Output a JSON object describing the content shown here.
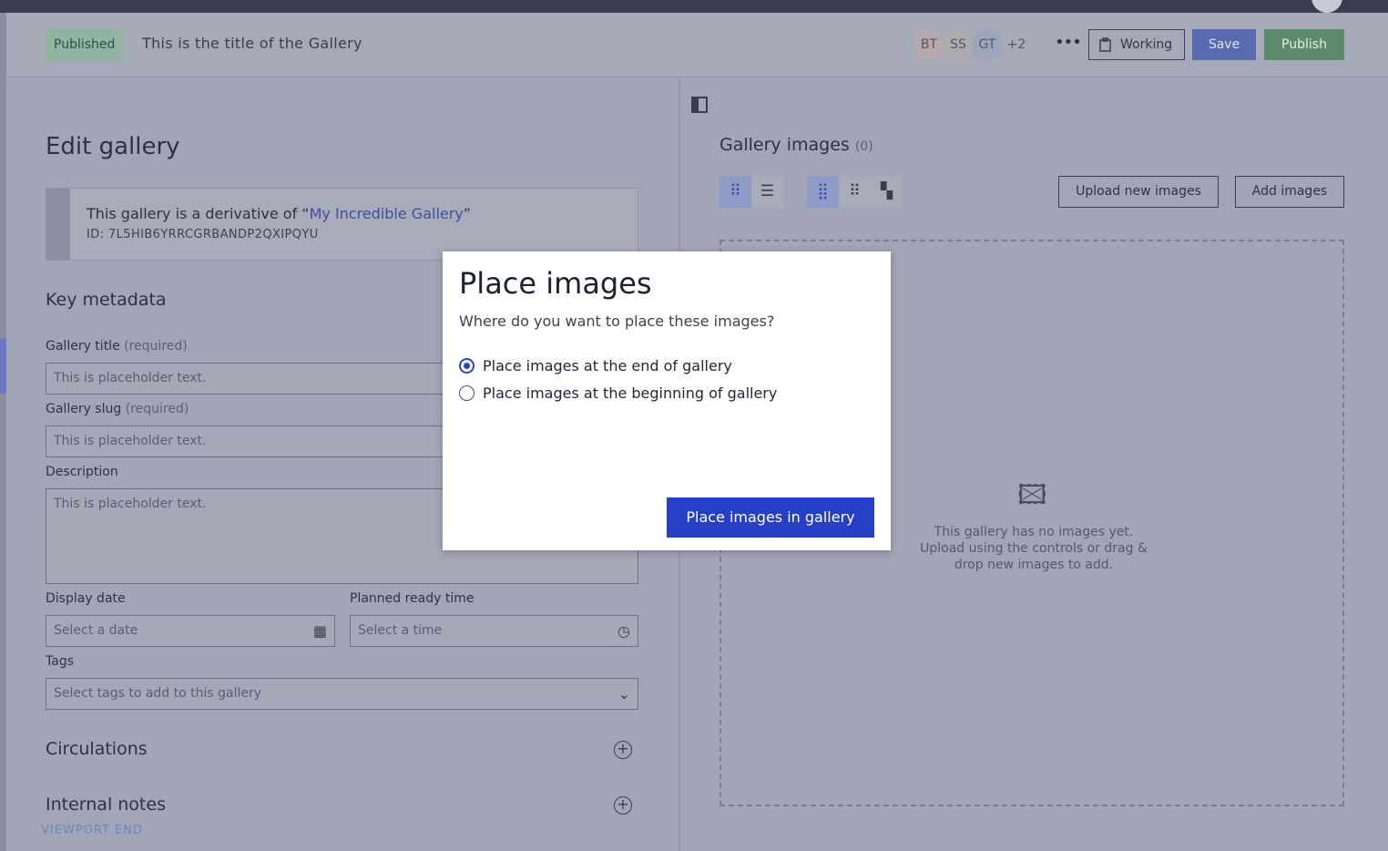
{
  "header": {
    "status_badge": "Published",
    "title": "This is the title of the Gallery",
    "collaborators": [
      "BT",
      "SS",
      "GT",
      "+2"
    ],
    "more_icon": "•••",
    "working_label": "Working",
    "save_label": "Save",
    "publish_label": "Publish"
  },
  "edit": {
    "heading": "Edit gallery",
    "derivative_prefix": "This gallery is a derivative of “",
    "derivative_link": "My Incredible Gallery",
    "derivative_suffix": "”",
    "derivative_id": "ID: 7L5HIB6YRRCGRBANDP2QXIPQYU",
    "key_metadata": "Key metadata",
    "gallery_title_label": "Gallery title",
    "gallery_slug_label": "Gallery slug",
    "required": "(required)",
    "description_label": "Description",
    "placeholder": "This is placeholder text.",
    "display_date_label": "Display date",
    "date_placeholder": "Select a date",
    "planned_time_label": "Planned ready time",
    "time_placeholder": "Select a time",
    "tags_label": "Tags",
    "tags_placeholder": "Select tags to add to this gallery",
    "circulations": "Circulations",
    "internal_notes": "Internal notes",
    "viewport_end": "VIEWPORT END"
  },
  "gallery": {
    "heading": "Gallery images",
    "count": "(0)",
    "upload_label": "Upload new images",
    "add_label": "Add images",
    "empty_line1": "This gallery has no images yet.",
    "empty_line2": "Upload using the controls or drag &",
    "empty_line3": "drop new images to add."
  },
  "modal": {
    "title": "Place images",
    "subtitle": "Where do you want to place these images?",
    "option_end": "Place images at the end of gallery",
    "option_beginning": "Place images at the beginning of gallery",
    "selected": "end",
    "confirm_label": "Place images in gallery"
  },
  "colors": {
    "primary": "#2540c6",
    "overlay": "#a3a6b6"
  }
}
